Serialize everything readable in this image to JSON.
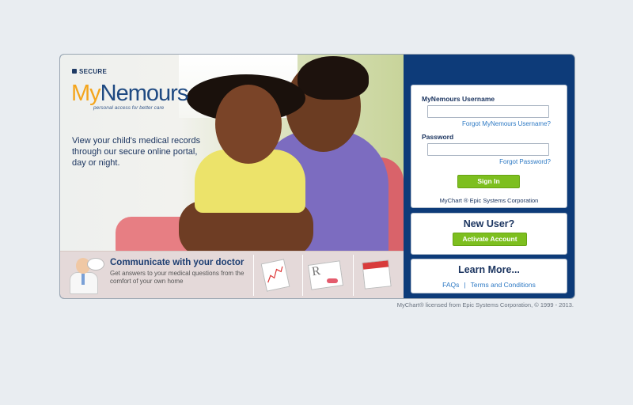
{
  "branding": {
    "secure_label": "SECURE",
    "logo_my": "My",
    "logo_name": "Nemours",
    "tagline": "personal access for better care",
    "intro_text": "View your child's medical records through our secure online portal, day or night."
  },
  "feature": {
    "title": "Communicate with your doctor",
    "description": "Get answers to your medical questions from the comfort of your own home",
    "rx_glyph": "R"
  },
  "login": {
    "username_label": "MyNemours Username",
    "username_value": "",
    "forgot_username": "Forgot MyNemours Username?",
    "password_label": "Password",
    "password_value": "",
    "forgot_password": "Forgot Password?",
    "signin_label": "Sign In",
    "powered_by": "MyChart ® Epic Systems Corporation"
  },
  "new_user": {
    "title": "New User?",
    "activate_label": "Activate Account"
  },
  "learn_more": {
    "title": "Learn More...",
    "faqs": "FAQs",
    "separator": "|",
    "terms": "Terms and Conditions"
  },
  "footer": {
    "license": "MyChart® licensed from Epic Systems Corporation, © 1999 - 2013."
  },
  "colors": {
    "page_bg": "#e9edf1",
    "panel_blue": "#0d3b79",
    "button_green": "#7dbf1f",
    "link_blue": "#2d79c4",
    "logo_orange": "#f4a51c"
  }
}
